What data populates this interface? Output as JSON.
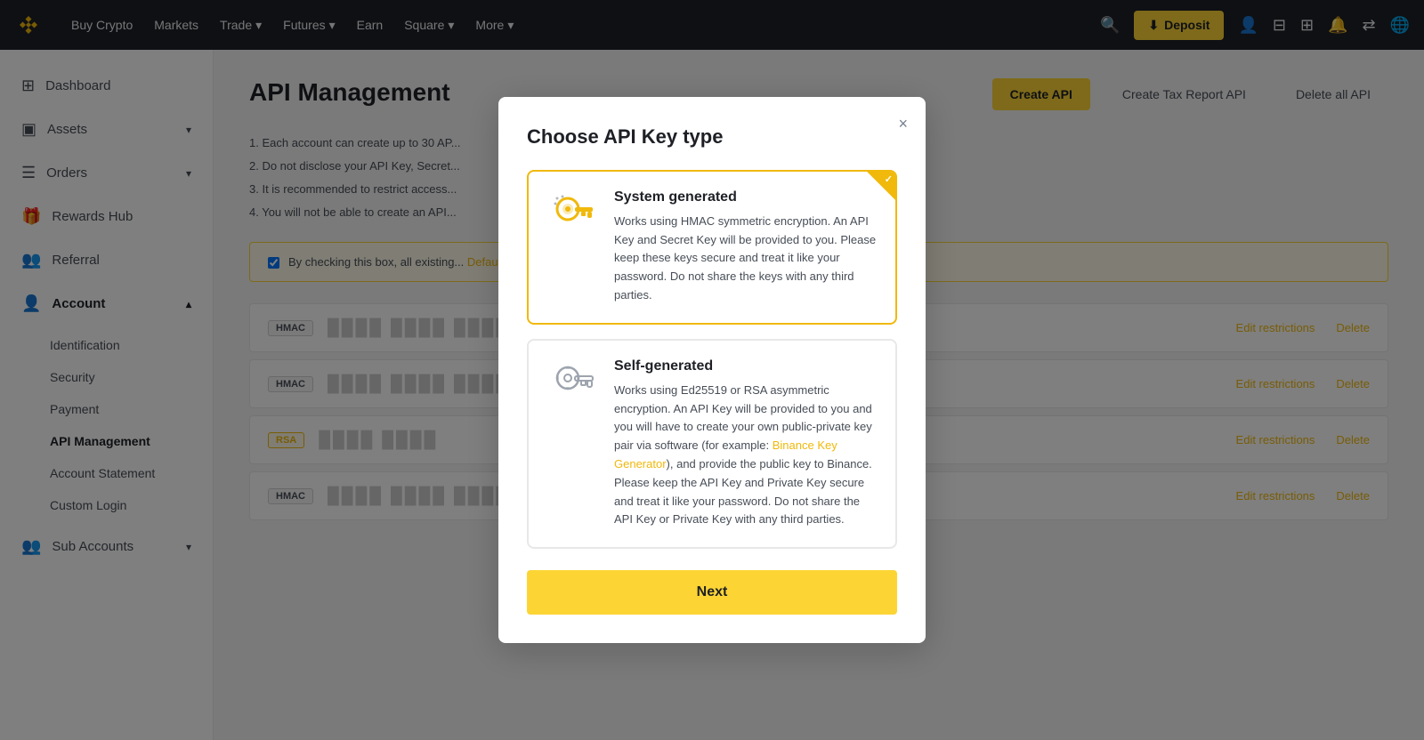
{
  "app": {
    "name": "Binance"
  },
  "topnav": {
    "links": [
      {
        "label": "Buy Crypto",
        "id": "buy-crypto"
      },
      {
        "label": "Markets",
        "id": "markets"
      },
      {
        "label": "Trade",
        "id": "trade",
        "hasChevron": true
      },
      {
        "label": "Futures",
        "id": "futures",
        "hasChevron": true
      },
      {
        "label": "Earn",
        "id": "earn"
      },
      {
        "label": "Square",
        "id": "square",
        "hasChevron": true
      },
      {
        "label": "More",
        "id": "more",
        "hasChevron": true
      }
    ],
    "deposit_label": "Deposit"
  },
  "sidebar": {
    "items": [
      {
        "label": "Dashboard",
        "id": "dashboard",
        "icon": "⊞"
      },
      {
        "label": "Assets",
        "id": "assets",
        "icon": "▣",
        "hasChevron": true
      },
      {
        "label": "Orders",
        "id": "orders",
        "icon": "☰",
        "hasChevron": true
      },
      {
        "label": "Rewards Hub",
        "id": "rewards-hub",
        "icon": "🎁"
      },
      {
        "label": "Referral",
        "id": "referral",
        "icon": "👥"
      },
      {
        "label": "Account",
        "id": "account",
        "icon": "👤",
        "hasChevron": true,
        "expanded": true
      }
    ],
    "account_sub": [
      {
        "label": "Identification",
        "id": "identification"
      },
      {
        "label": "Security",
        "id": "security"
      },
      {
        "label": "Payment",
        "id": "payment"
      },
      {
        "label": "API Management",
        "id": "api-management",
        "active": true
      },
      {
        "label": "Account Statement",
        "id": "account-statement"
      },
      {
        "label": "Custom Login",
        "id": "custom-login"
      }
    ],
    "sub_accounts": {
      "label": "Sub Accounts",
      "id": "sub-accounts",
      "icon": "👥",
      "hasChevron": true
    }
  },
  "page": {
    "title": "API Management",
    "actions": {
      "create_api": "Create API",
      "create_tax_report": "Create Tax Report API",
      "delete_all": "Delete all API"
    },
    "notes": [
      "1. Each account can create up to 30 AP...",
      "2. Do not disclose your API Key, Secret...",
      "3. It is recommended to restrict access...",
      "4. You will not be able to create an API..."
    ],
    "notice": {
      "text": "By checking this box, all existing...",
      "link": "Default Security Controls Detail...",
      "link_url": "#"
    },
    "api_rows": [
      {
        "badge": "HMAC",
        "badge_type": "hmac",
        "blur": "████ ████ ████",
        "edit": "Edit restrictions",
        "delete": "Delete"
      },
      {
        "badge": "HMAC",
        "badge_type": "hmac",
        "blur": "████ ████ ████",
        "edit": "Edit restrictions",
        "delete": "Delete"
      },
      {
        "badge": "RSA",
        "badge_type": "rsa",
        "blur": "████ ████",
        "edit": "Edit restrictions",
        "delete": "Delete"
      },
      {
        "badge": "HMAC",
        "badge_type": "hmac",
        "blur": "████ ████ ████",
        "edit": "Edit restrictions",
        "delete": "Delete"
      }
    ]
  },
  "modal": {
    "title": "Choose API Key type",
    "close_label": "×",
    "options": [
      {
        "id": "system-generated",
        "title": "System generated",
        "description": "Works using HMAC symmetric encryption. An API Key and Secret Key will be provided to you. Please keep these keys secure and treat it like your password. Do not share the keys with any third parties.",
        "selected": true,
        "icon_type": "key-gold"
      },
      {
        "id": "self-generated",
        "title": "Self-generated",
        "description": "Works using Ed25519 or RSA asymmetric encryption. An API Key will be provided to you and you will have to create your own public-private key pair via software (for example: ",
        "description_link": "Binance Key Generator",
        "description_after": "), and provide the public key to Binance. Please keep the API Key and Private Key secure and treat it like your password. Do not share the API Key or Private Key with any third parties.",
        "selected": false,
        "icon_type": "key-outline"
      }
    ],
    "next_button": "Next"
  }
}
